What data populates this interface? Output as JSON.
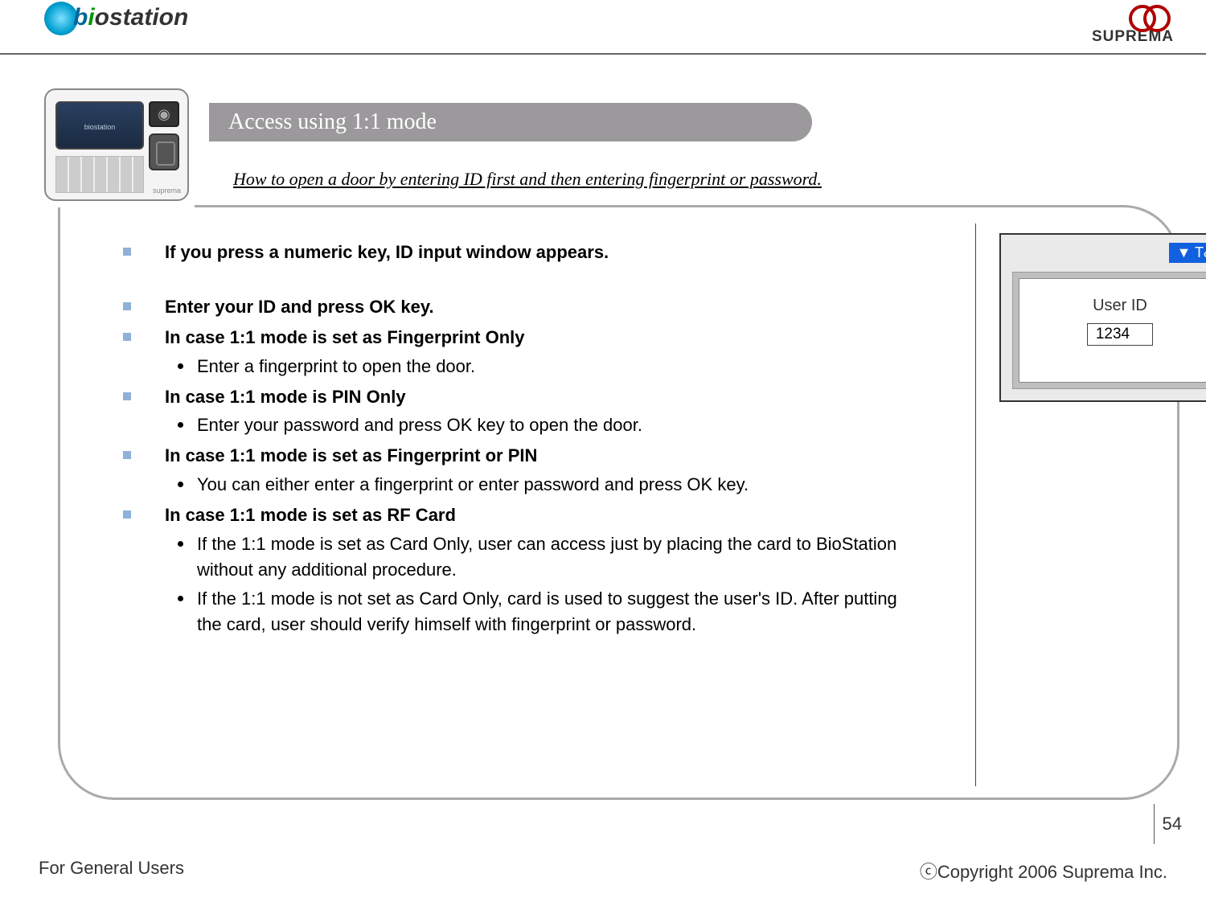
{
  "header": {
    "left_logo_text": "biostation",
    "right_logo_text": "SUPREMA"
  },
  "page": {
    "title": "Access using 1:1 mode",
    "subtitle": "How to open a door by entering ID first and then entering fingerprint or password.",
    "number": "54"
  },
  "content": {
    "items": [
      {
        "text": "If you press a numeric key, ID input window appears.",
        "sub": []
      },
      {
        "text": "Enter your ID and press OK key.",
        "sub": []
      },
      {
        "text": "In case 1:1 mode is set as Fingerprint Only",
        "sub": [
          "Enter a fingerprint to open the door."
        ]
      },
      {
        "text": "In case 1:1 mode is PIN Only",
        "sub": [
          "Enter your password and press OK key to open the door."
        ]
      },
      {
        "text": "In case 1:1 mode is set as Fingerprint or PIN",
        "sub": [
          "You can either enter a fingerprint or enter password and press OK key."
        ]
      },
      {
        "text": "In case 1:1 mode is set as RF Card",
        "sub": [
          "If the 1:1 mode is set as Card Only, user can access just by placing the card to BioStation without any additional procedure.",
          "If the 1:1 mode is not set as Card Only, card is used to suggest the user's ID. After putting the card, user should verify himself with fingerprint or password."
        ]
      }
    ]
  },
  "device_screen": {
    "ta_label": "▼ T&A",
    "field_label": "User ID",
    "field_value": "1234"
  },
  "device_thumb": {
    "screen_text": "biostation",
    "brand_text": "suprema"
  },
  "footer": {
    "left": "For General Users",
    "right": "ⓒCopyright 2006 Suprema Inc."
  }
}
